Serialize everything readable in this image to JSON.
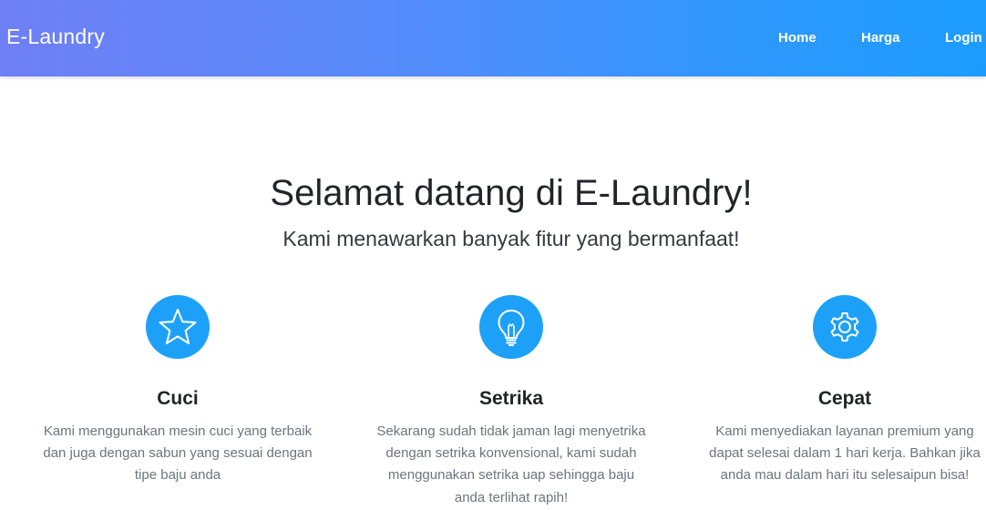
{
  "navbar": {
    "brand": "E-Laundry",
    "links": [
      {
        "label": "Home"
      },
      {
        "label": "Harga"
      },
      {
        "label": "Login"
      }
    ],
    "gradient": [
      "#6f7ff5",
      "#1c9cff"
    ]
  },
  "hero": {
    "title": "Selamat datang di E-Laundry!",
    "subtitle": "Kami menawarkan banyak fitur yang bermanfaat!"
  },
  "features": [
    {
      "icon": "star-icon",
      "title": "Cuci",
      "text": "Kami menggunakan mesin cuci yang terbaik dan juga dengan sabun yang sesuai dengan tipe baju anda"
    },
    {
      "icon": "lightbulb-icon",
      "title": "Setrika",
      "text": "Sekarang sudah tidak jaman lagi menyetrika dengan setrika konvensional, kami sudah menggunakan setrika uap sehingga baju anda terlihat rapih!"
    },
    {
      "icon": "gear-icon",
      "title": "Cepat",
      "text": "Kami menyediakan layanan premium yang dapat selesai dalam 1 hari kerja. Bahkan jika anda mau dalam hari itu selesaipun bisa!"
    }
  ],
  "colors": {
    "icon_circle": "#1da1f8",
    "feature_text": "#6c757d"
  }
}
